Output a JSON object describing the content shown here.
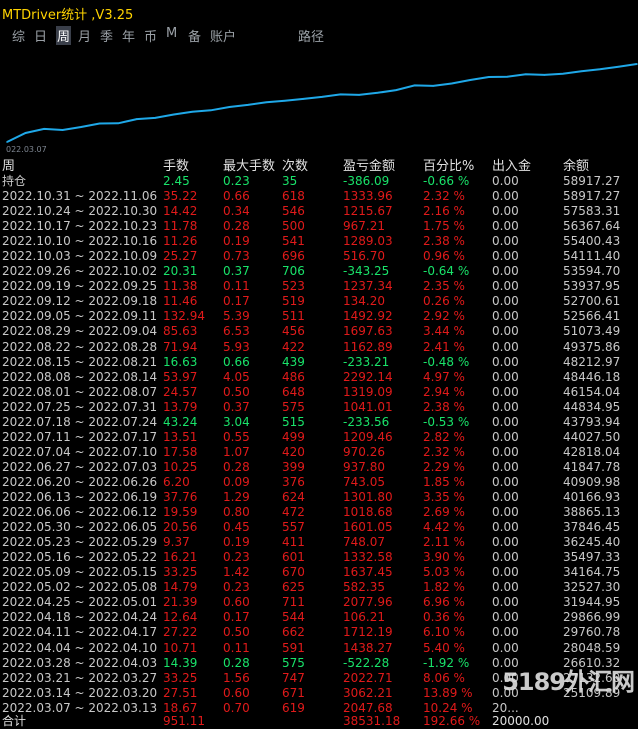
{
  "window": {
    "title": "MTDriver统计 ,V3.25"
  },
  "tabs": [
    {
      "label": "综",
      "active": false
    },
    {
      "label": "日",
      "active": false
    },
    {
      "label": "周",
      "active": true
    },
    {
      "label": "月",
      "active": false
    },
    {
      "label": "季",
      "active": false
    },
    {
      "label": "年",
      "active": false
    },
    {
      "label": "币",
      "active": false
    },
    {
      "label": "M",
      "active": false
    },
    {
      "label": "备",
      "active": false
    },
    {
      "label": "账户",
      "active": false
    },
    {
      "label": "路径",
      "active": false
    }
  ],
  "chart": {
    "start_date_label": "022.03.07",
    "line_color": "#1fa8e8"
  },
  "chart_data": {
    "type": "line",
    "x": [
      "2022.03.07",
      "2022.03.14",
      "2022.03.21",
      "2022.03.28",
      "2022.04.04",
      "2022.04.11",
      "2022.04.18",
      "2022.04.25",
      "2022.05.02",
      "2022.05.09",
      "2022.05.16",
      "2022.05.23",
      "2022.05.30",
      "2022.06.06",
      "2022.06.13",
      "2022.06.20",
      "2022.06.27",
      "2022.07.04",
      "2022.07.11",
      "2022.07.18",
      "2022.07.25",
      "2022.08.01",
      "2022.08.08",
      "2022.08.15",
      "2022.08.22",
      "2022.08.29",
      "2022.09.05",
      "2022.09.12",
      "2022.09.19",
      "2022.09.26",
      "2022.10.03",
      "2022.10.10",
      "2022.10.17",
      "2022.10.24",
      "2022.10.31"
    ],
    "values": [
      20718.37,
      25109.89,
      27132.6,
      26610.32,
      28048.59,
      29760.78,
      29866.99,
      31944.95,
      32527.3,
      34164.75,
      35497.33,
      36245.4,
      37846.45,
      38865.13,
      40166.93,
      40909.98,
      41847.78,
      42818.04,
      44027.5,
      43793.94,
      44834.95,
      46154.04,
      48446.18,
      48212.97,
      49375.86,
      51073.49,
      52566.41,
      52700.61,
      53937.95,
      53594.7,
      54111.4,
      55400.43,
      56367.64,
      57583.31,
      58917.27
    ],
    "xlabel": "",
    "ylabel": ""
  },
  "table": {
    "headers": {
      "period": "周",
      "lots": "手数",
      "maxlots": "最大手数",
      "count": "次数",
      "pnl": "盈亏金额",
      "pct": "百分比%",
      "io": "出入金",
      "bal": "余额"
    },
    "holding": {
      "period": "持仓",
      "lots": "2.45",
      "maxlots": "0.23",
      "count": "35",
      "pnl": "-386.09",
      "pct": "-0.66 %",
      "io": "0.00",
      "bal": "58917.27",
      "color": "green"
    },
    "rows": [
      {
        "period": "2022.10.31 ~ 2022.11.06",
        "lots": "35.22",
        "maxlots": "0.66",
        "count": "618",
        "pnl": "1333.96",
        "pct": "2.32 %",
        "io": "0.00",
        "bal": "58917.27",
        "color": "red"
      },
      {
        "period": "2022.10.24 ~ 2022.10.30",
        "lots": "14.42",
        "maxlots": "0.34",
        "count": "546",
        "pnl": "1215.67",
        "pct": "2.16 %",
        "io": "0.00",
        "bal": "57583.31",
        "color": "red"
      },
      {
        "period": "2022.10.17 ~ 2022.10.23",
        "lots": "11.78",
        "maxlots": "0.28",
        "count": "500",
        "pnl": "967.21",
        "pct": "1.75 %",
        "io": "0.00",
        "bal": "56367.64",
        "color": "red"
      },
      {
        "period": "2022.10.10 ~ 2022.10.16",
        "lots": "11.26",
        "maxlots": "0.19",
        "count": "541",
        "pnl": "1289.03",
        "pct": "2.38 %",
        "io": "0.00",
        "bal": "55400.43",
        "color": "red"
      },
      {
        "period": "2022.10.03 ~ 2022.10.09",
        "lots": "25.27",
        "maxlots": "0.73",
        "count": "696",
        "pnl": "516.70",
        "pct": "0.96 %",
        "io": "0.00",
        "bal": "54111.40",
        "color": "red"
      },
      {
        "period": "2022.09.26 ~ 2022.10.02",
        "lots": "20.31",
        "maxlots": "0.37",
        "count": "706",
        "pnl": "-343.25",
        "pct": "-0.64 %",
        "io": "0.00",
        "bal": "53594.70",
        "color": "green"
      },
      {
        "period": "2022.09.19 ~ 2022.09.25",
        "lots": "11.38",
        "maxlots": "0.11",
        "count": "523",
        "pnl": "1237.34",
        "pct": "2.35 %",
        "io": "0.00",
        "bal": "53937.95",
        "color": "red"
      },
      {
        "period": "2022.09.12 ~ 2022.09.18",
        "lots": "11.46",
        "maxlots": "0.17",
        "count": "519",
        "pnl": "134.20",
        "pct": "0.26 %",
        "io": "0.00",
        "bal": "52700.61",
        "color": "red"
      },
      {
        "period": "2022.09.05 ~ 2022.09.11",
        "lots": "132.94",
        "maxlots": "5.39",
        "count": "511",
        "pnl": "1492.92",
        "pct": "2.92 %",
        "io": "0.00",
        "bal": "52566.41",
        "color": "red"
      },
      {
        "period": "2022.08.29 ~ 2022.09.04",
        "lots": "85.63",
        "maxlots": "6.53",
        "count": "456",
        "pnl": "1697.63",
        "pct": "3.44 %",
        "io": "0.00",
        "bal": "51073.49",
        "color": "red"
      },
      {
        "period": "2022.08.22 ~ 2022.08.28",
        "lots": "71.94",
        "maxlots": "5.93",
        "count": "422",
        "pnl": "1162.89",
        "pct": "2.41 %",
        "io": "0.00",
        "bal": "49375.86",
        "color": "red"
      },
      {
        "period": "2022.08.15 ~ 2022.08.21",
        "lots": "16.63",
        "maxlots": "0.66",
        "count": "439",
        "pnl": "-233.21",
        "pct": "-0.48 %",
        "io": "0.00",
        "bal": "48212.97",
        "color": "green"
      },
      {
        "period": "2022.08.08 ~ 2022.08.14",
        "lots": "53.97",
        "maxlots": "4.05",
        "count": "486",
        "pnl": "2292.14",
        "pct": "4.97 %",
        "io": "0.00",
        "bal": "48446.18",
        "color": "red"
      },
      {
        "period": "2022.08.01 ~ 2022.08.07",
        "lots": "24.57",
        "maxlots": "0.50",
        "count": "648",
        "pnl": "1319.09",
        "pct": "2.94 %",
        "io": "0.00",
        "bal": "46154.04",
        "color": "red"
      },
      {
        "period": "2022.07.25 ~ 2022.07.31",
        "lots": "13.79",
        "maxlots": "0.37",
        "count": "575",
        "pnl": "1041.01",
        "pct": "2.38 %",
        "io": "0.00",
        "bal": "44834.95",
        "color": "red"
      },
      {
        "period": "2022.07.18 ~ 2022.07.24",
        "lots": "43.24",
        "maxlots": "3.04",
        "count": "515",
        "pnl": "-233.56",
        "pct": "-0.53 %",
        "io": "0.00",
        "bal": "43793.94",
        "color": "green"
      },
      {
        "period": "2022.07.11 ~ 2022.07.17",
        "lots": "13.51",
        "maxlots": "0.55",
        "count": "499",
        "pnl": "1209.46",
        "pct": "2.82 %",
        "io": "0.00",
        "bal": "44027.50",
        "color": "red"
      },
      {
        "period": "2022.07.04 ~ 2022.07.10",
        "lots": "17.58",
        "maxlots": "1.07",
        "count": "420",
        "pnl": "970.26",
        "pct": "2.32 %",
        "io": "0.00",
        "bal": "42818.04",
        "color": "red"
      },
      {
        "period": "2022.06.27 ~ 2022.07.03",
        "lots": "10.25",
        "maxlots": "0.28",
        "count": "399",
        "pnl": "937.80",
        "pct": "2.29 %",
        "io": "0.00",
        "bal": "41847.78",
        "color": "red"
      },
      {
        "period": "2022.06.20 ~ 2022.06.26",
        "lots": "6.20",
        "maxlots": "0.09",
        "count": "376",
        "pnl": "743.05",
        "pct": "1.85 %",
        "io": "0.00",
        "bal": "40909.98",
        "color": "red"
      },
      {
        "period": "2022.06.13 ~ 2022.06.19",
        "lots": "37.76",
        "maxlots": "1.29",
        "count": "624",
        "pnl": "1301.80",
        "pct": "3.35 %",
        "io": "0.00",
        "bal": "40166.93",
        "color": "red"
      },
      {
        "period": "2022.06.06 ~ 2022.06.12",
        "lots": "19.59",
        "maxlots": "0.80",
        "count": "472",
        "pnl": "1018.68",
        "pct": "2.69 %",
        "io": "0.00",
        "bal": "38865.13",
        "color": "red"
      },
      {
        "period": "2022.05.30 ~ 2022.06.05",
        "lots": "20.56",
        "maxlots": "0.45",
        "count": "557",
        "pnl": "1601.05",
        "pct": "4.42 %",
        "io": "0.00",
        "bal": "37846.45",
        "color": "red"
      },
      {
        "period": "2022.05.23 ~ 2022.05.29",
        "lots": "9.37",
        "maxlots": "0.19",
        "count": "411",
        "pnl": "748.07",
        "pct": "2.11 %",
        "io": "0.00",
        "bal": "36245.40",
        "color": "red"
      },
      {
        "period": "2022.05.16 ~ 2022.05.22",
        "lots": "16.21",
        "maxlots": "0.23",
        "count": "601",
        "pnl": "1332.58",
        "pct": "3.90 %",
        "io": "0.00",
        "bal": "35497.33",
        "color": "red"
      },
      {
        "period": "2022.05.09 ~ 2022.05.15",
        "lots": "33.25",
        "maxlots": "1.42",
        "count": "670",
        "pnl": "1637.45",
        "pct": "5.03 %",
        "io": "0.00",
        "bal": "34164.75",
        "color": "red"
      },
      {
        "period": "2022.05.02 ~ 2022.05.08",
        "lots": "14.79",
        "maxlots": "0.23",
        "count": "625",
        "pnl": "582.35",
        "pct": "1.82 %",
        "io": "0.00",
        "bal": "32527.30",
        "color": "red"
      },
      {
        "period": "2022.04.25 ~ 2022.05.01",
        "lots": "21.39",
        "maxlots": "0.60",
        "count": "711",
        "pnl": "2077.96",
        "pct": "6.96 %",
        "io": "0.00",
        "bal": "31944.95",
        "color": "red"
      },
      {
        "period": "2022.04.18 ~ 2022.04.24",
        "lots": "12.64",
        "maxlots": "0.17",
        "count": "544",
        "pnl": "106.21",
        "pct": "0.36 %",
        "io": "0.00",
        "bal": "29866.99",
        "color": "red"
      },
      {
        "period": "2022.04.11 ~ 2022.04.17",
        "lots": "27.22",
        "maxlots": "0.50",
        "count": "662",
        "pnl": "1712.19",
        "pct": "6.10 %",
        "io": "0.00",
        "bal": "29760.78",
        "color": "red"
      },
      {
        "period": "2022.04.04 ~ 2022.04.10",
        "lots": "10.71",
        "maxlots": "0.11",
        "count": "591",
        "pnl": "1438.27",
        "pct": "5.40 %",
        "io": "0.00",
        "bal": "28048.59",
        "color": "red"
      },
      {
        "period": "2022.03.28 ~ 2022.04.03",
        "lots": "14.39",
        "maxlots": "0.28",
        "count": "575",
        "pnl": "-522.28",
        "pct": "-1.92 %",
        "io": "0.00",
        "bal": "26610.32",
        "color": "green"
      },
      {
        "period": "2022.03.21 ~ 2022.03.27",
        "lots": "33.25",
        "maxlots": "1.56",
        "count": "747",
        "pnl": "2022.71",
        "pct": "8.06 %",
        "io": "0.00",
        "bal": "27132.60",
        "color": "red"
      },
      {
        "period": "2022.03.14 ~ 2022.03.20",
        "lots": "27.51",
        "maxlots": "0.60",
        "count": "671",
        "pnl": "3062.21",
        "pct": "13.89 %",
        "io": "0.00",
        "bal": "25109.89",
        "color": "red"
      },
      {
        "period": "2022.03.07 ~ 2022.03.13",
        "lots": "18.67",
        "maxlots": "0.70",
        "count": "619",
        "pnl": "2047.68",
        "pct": "10.24 %",
        "io": "20...",
        "bal": "",
        "color": "red"
      }
    ],
    "total": {
      "label": "合计",
      "lots": "951.11",
      "pnl": "38531.18",
      "pct": "192.66 %",
      "io": "20000.00"
    }
  },
  "watermark": "5189外汇网"
}
